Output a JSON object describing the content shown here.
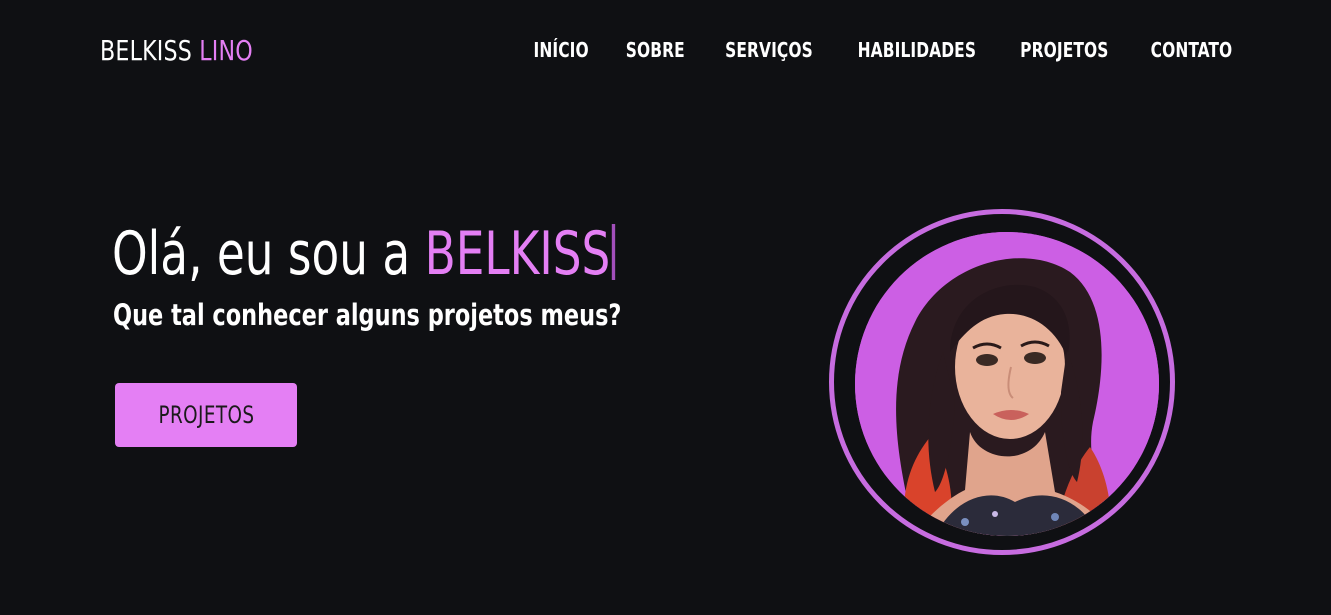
{
  "header": {
    "logo_first": "BELKISS",
    "logo_second": "LINO",
    "nav": [
      "INÍCIO",
      "SOBRE",
      "SERVIÇOS",
      "HABILIDADES",
      "PROJETOS",
      "CONTATO"
    ]
  },
  "hero": {
    "greeting": "Olá, eu sou a ",
    "name": "BELKISS",
    "subtitle": "Que tal conhecer alguns projetos meus?",
    "cta_label": "PROJETOS"
  },
  "colors": {
    "background": "#0f1013",
    "accent": "#e47ff4",
    "ring": "#c76ce0",
    "avatar_bg": "#c95be2"
  }
}
